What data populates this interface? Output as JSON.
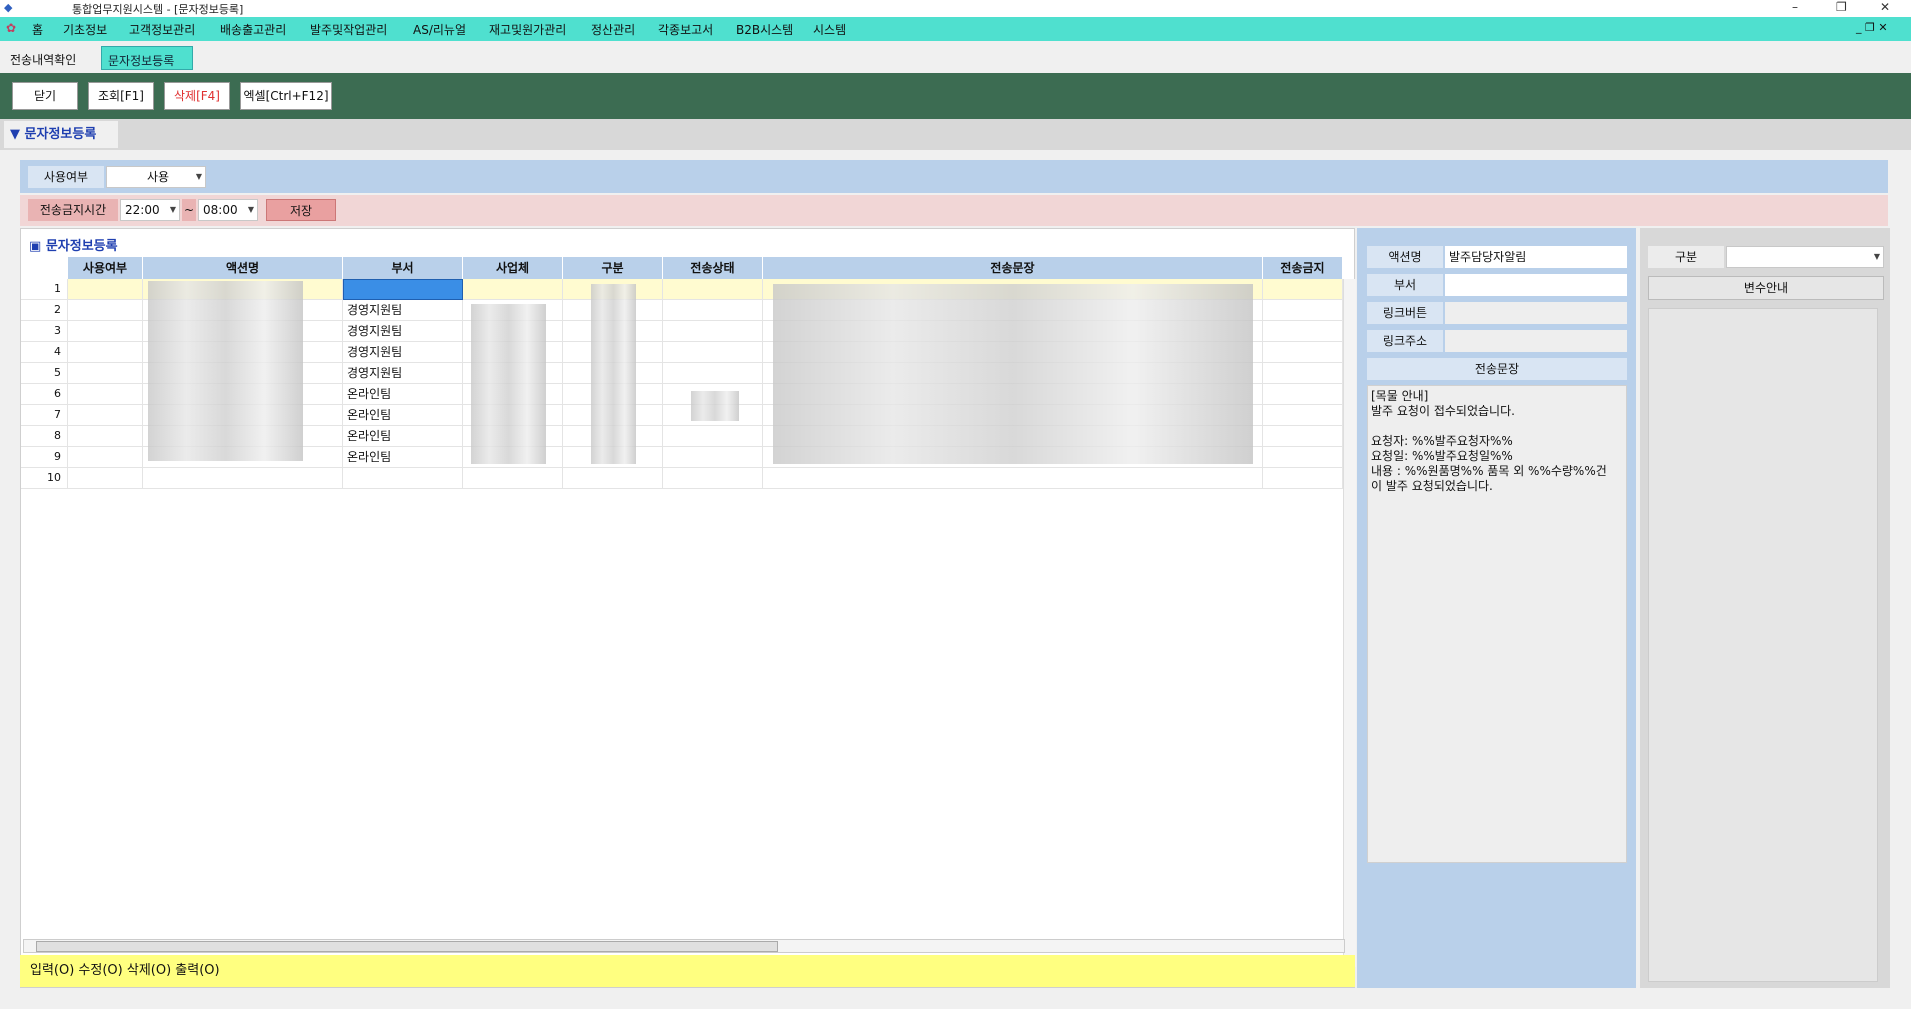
{
  "window": {
    "title": "통합업무지원시스템 - [문자정보등록]",
    "min": "–",
    "restore": "❐",
    "close": "✕"
  },
  "menu": [
    "홈",
    "기초정보",
    "고객정보관리",
    "배송출고관리",
    "발주및작업관리",
    "AS/리뉴얼",
    "재고및원가관리",
    "정산관리",
    "각종보고서",
    "B2B시스템",
    "시스템"
  ],
  "tabs": [
    "전송내역확인",
    "문자정보등록"
  ],
  "toolbar": {
    "close": "닫기",
    "search": "조회[F1]",
    "delete": "삭제[F4]",
    "excel": "엑셀[Ctrl+F12]"
  },
  "section_title": "문자정보등록",
  "filters": {
    "use_label": "사용여부",
    "use_value": "사용",
    "block_label": "전송금지시간",
    "block_from": "22:00",
    "tilde": "~",
    "block_to": "08:00",
    "save": "저장"
  },
  "grid": {
    "caption": "문자정보등록",
    "columns": [
      "사용여부",
      "액션명",
      "부서",
      "사업체",
      "구분",
      "전송상태",
      "전송문장",
      "전송금지"
    ],
    "rows": [
      {
        "no": "1",
        "dept": ""
      },
      {
        "no": "2",
        "dept": "경영지원팀"
      },
      {
        "no": "3",
        "dept": "경영지원팀"
      },
      {
        "no": "4",
        "dept": "경영지원팀"
      },
      {
        "no": "5",
        "dept": "경영지원팀"
      },
      {
        "no": "6",
        "dept": "온라인팀"
      },
      {
        "no": "7",
        "dept": "온라인팀"
      },
      {
        "no": "8",
        "dept": "온라인팀"
      },
      {
        "no": "9",
        "dept": "온라인팀"
      },
      {
        "no": "10",
        "dept": ""
      }
    ]
  },
  "status": "입력(O) 수정(O) 삭제(O) 출력(O)",
  "detail": {
    "action_label": "액션명",
    "action_value": "발주담당자알림",
    "dept_label": "부서",
    "link_btn_label": "링크버튼",
    "link_url_label": "링크주소",
    "message_label": "전송문장",
    "message": "[목물 안내]\n발주 요청이 접수되었습니다.\n\n요청자: %%발주요청자%%\n요청일: %%발주요청일%%\n내용 : %%원품명%% 품목 외 %%수량%%건\n이 발주 요청되었습니다."
  },
  "far": {
    "type_label": "구분",
    "var_button": "변수안내"
  }
}
